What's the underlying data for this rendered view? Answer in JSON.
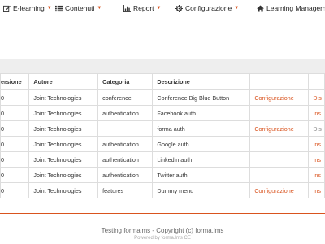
{
  "nav": {
    "elearning": "E-learning",
    "contenuti": "Contenuti",
    "report": "Report",
    "configurazione": "Configurazione",
    "learning_management": "Learning Management"
  },
  "table": {
    "headers": [
      "ersione",
      "Autore",
      "Categoria",
      "Descrizione",
      "",
      ""
    ],
    "rows": [
      {
        "version": "0",
        "author": "Joint Technologies",
        "category": "conference",
        "description": "Conference Big Blue Button",
        "action": "Configurazione",
        "last": "Dis"
      },
      {
        "version": "0",
        "author": "Joint Technologies",
        "category": "authentication",
        "description": "Facebook auth",
        "action": "",
        "last": "Ins"
      },
      {
        "version": "0",
        "author": "Joint Technologies",
        "category": "",
        "description": "forma auth",
        "action": "Configurazione",
        "last": "Dis"
      },
      {
        "version": "0",
        "author": "Joint Technologies",
        "category": "authentication",
        "description": "Google auth",
        "action": "",
        "last": "Ins"
      },
      {
        "version": "0",
        "author": "Joint Technologies",
        "category": "authentication",
        "description": "Linkedin auth",
        "action": "",
        "last": "Ins"
      },
      {
        "version": "0",
        "author": "Joint Technologies",
        "category": "authentication",
        "description": "Twitter auth",
        "action": "",
        "last": "Ins"
      },
      {
        "version": "0",
        "author": "Joint Technologies",
        "category": "features",
        "description": "Dummy menu",
        "action": "Configurazione",
        "last": "Ins"
      }
    ]
  },
  "footer": {
    "main": "Testing formalms - Copyright (c) forma.lms",
    "sub": "Powered by forma.lms CE"
  },
  "colors": {
    "accent": "#d9531e",
    "muted_link": "#888888"
  },
  "icons": [
    "edit-icon",
    "list-icon",
    "bar-chart-icon",
    "gears-icon",
    "home-icon"
  ]
}
